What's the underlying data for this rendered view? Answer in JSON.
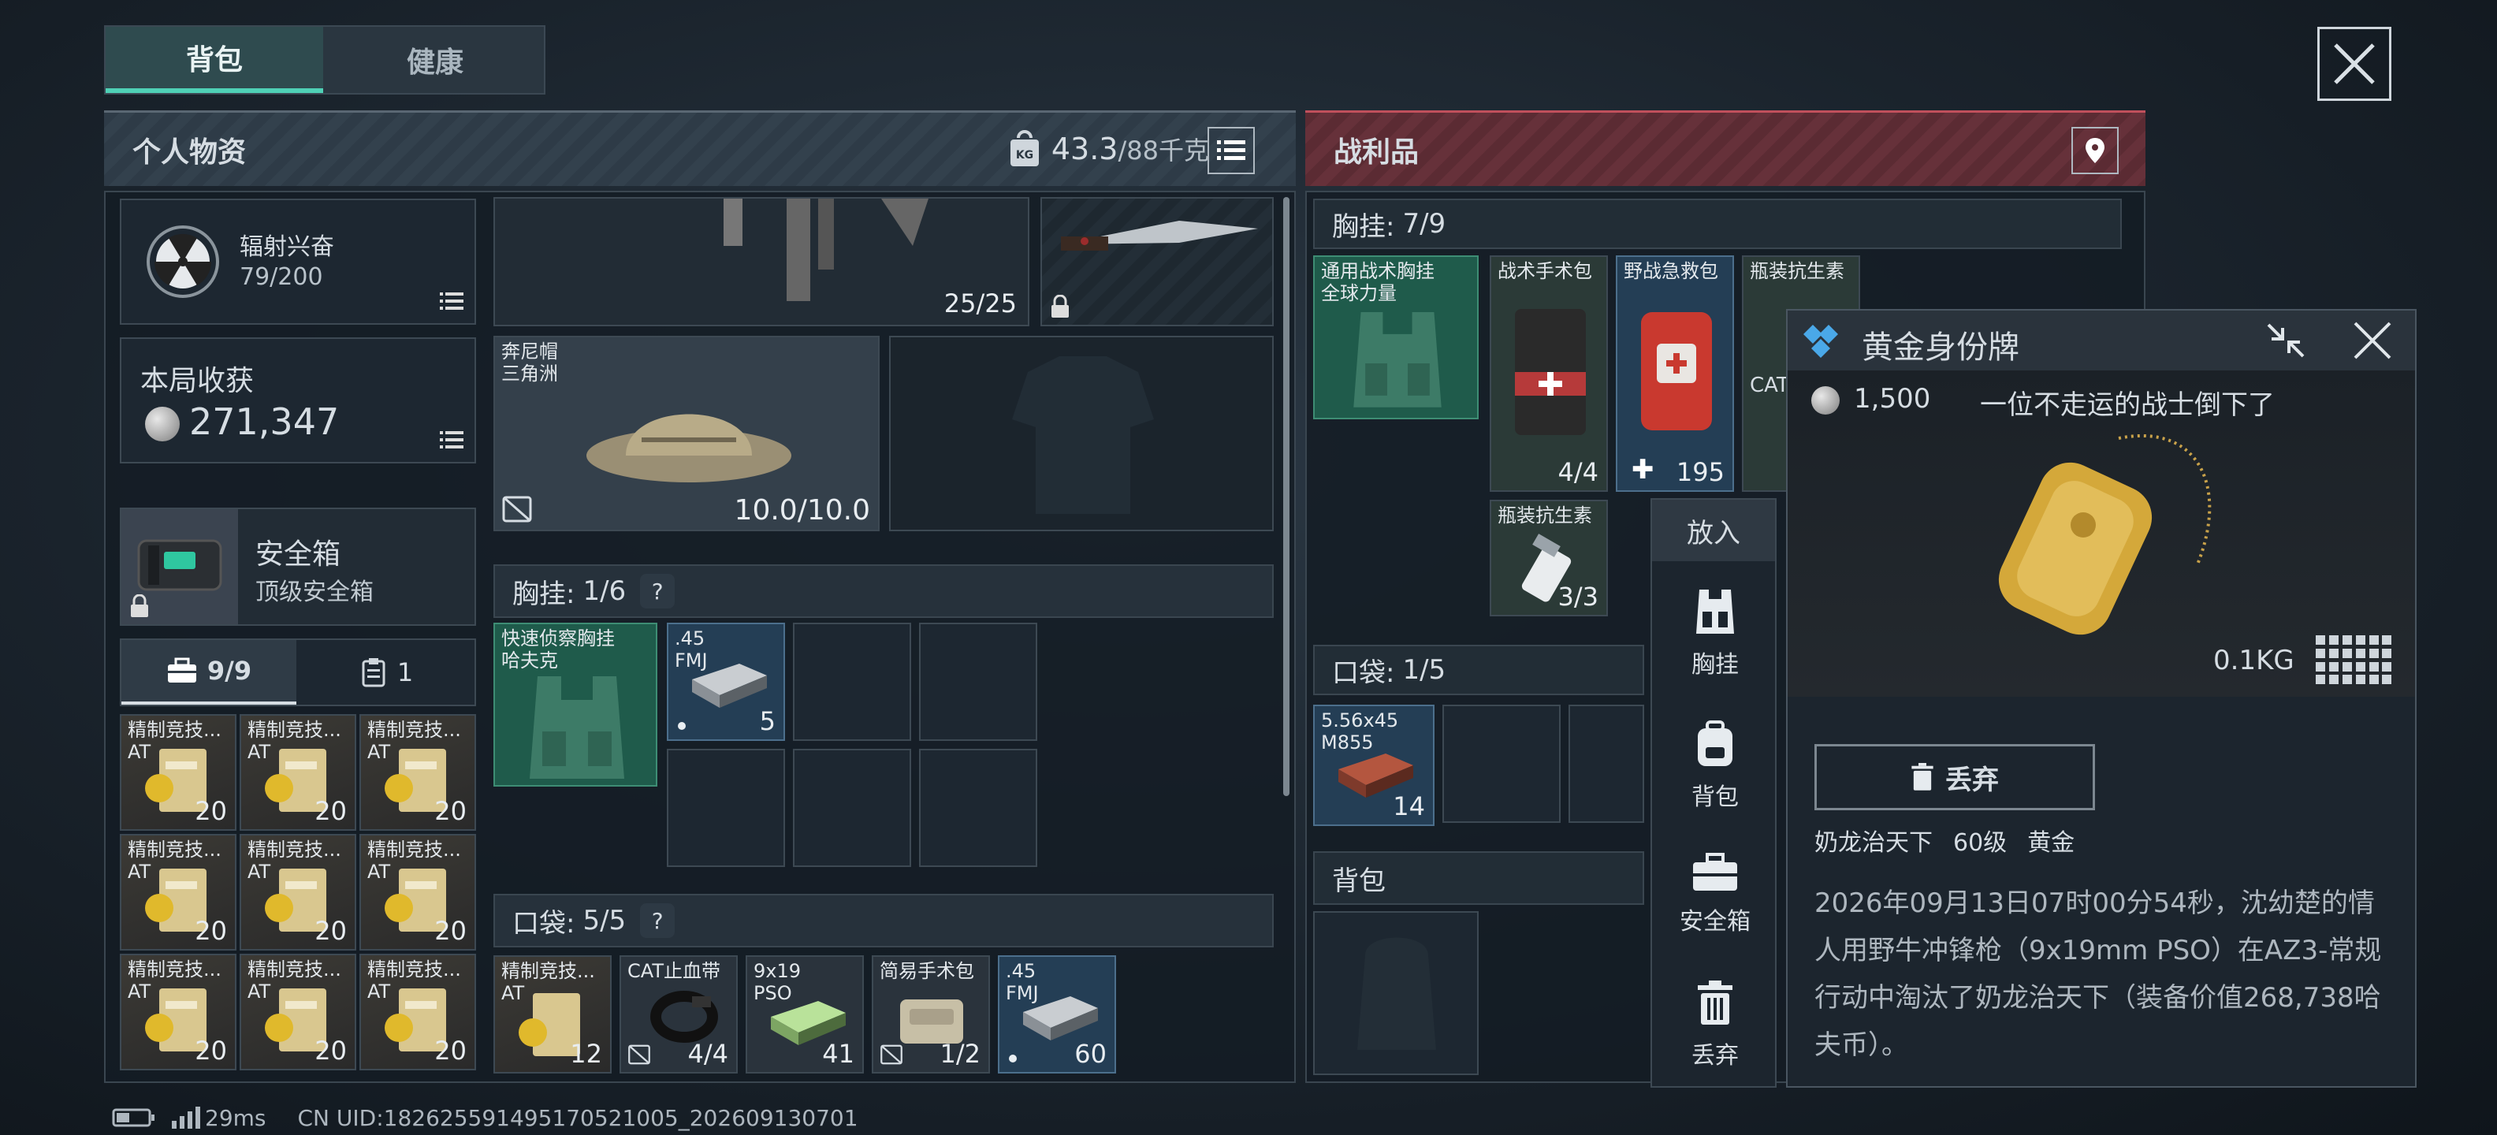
{
  "tabs": {
    "backpack": "背包",
    "health": "健康"
  },
  "left_header": {
    "title": "个人物资",
    "weight_current": "43.3",
    "weight_max": "/88千克"
  },
  "right_header": {
    "title": "战利品"
  },
  "stats": {
    "radiation_label": "辐射兴奋",
    "radiation_value": "79/200",
    "harvest_label": "本局收获",
    "harvest_value": "271,347"
  },
  "safe_box": {
    "title": "安全箱",
    "subtitle": "顶级安全箱"
  },
  "storage_tabs": {
    "case_count": "9/9",
    "clipboard_count": "1"
  },
  "grid_items": {
    "label": "精制竞技...\nAT",
    "count": "20"
  },
  "weapon_slots": {
    "rifle_ammo": "25/25"
  },
  "hat": {
    "name": "奔尼帽\n三角洲",
    "durability": "10.0/10.0"
  },
  "chest_rig_section": {
    "label": "胸挂:",
    "value": "1/6",
    "help": "?"
  },
  "chest_rig_item": {
    "name": "快速侦察胸挂\n哈夫克"
  },
  "ammo_45": {
    "name": ".45\nFMJ",
    "count": "5"
  },
  "pockets_section": {
    "label": "口袋:",
    "value": "5/5",
    "help": "?"
  },
  "pocket_items": [
    {
      "name": "精制竞技...\nAT",
      "count": "12"
    },
    {
      "name": "CAT止血带",
      "count": "4/4"
    },
    {
      "name": "9x19\nPSO",
      "count": "41"
    },
    {
      "name": "简易手术包",
      "count": "1/2"
    },
    {
      "name": ".45\nFMJ",
      "count": "60"
    }
  ],
  "loot": {
    "chest_rig_label": "胸挂:",
    "chest_rig_value": "7/9",
    "rig_item": "通用战术胸挂\n全球力量",
    "surgery_kit": {
      "name": "战术手术包",
      "count": "4/4"
    },
    "field_kit": {
      "name": "野战急救包",
      "count": "195"
    },
    "antibiotic": {
      "name": "瓶装抗生素",
      "count": "3/3"
    },
    "antibiotic_top": "瓶装抗生素",
    "cat_partial": "CAT",
    "pockets_label": "口袋:",
    "pockets_value": "1/5",
    "ammo_556": {
      "name": "5.56x45\nM855",
      "count": "14"
    },
    "backpack_label": "背包"
  },
  "side_menu": {
    "title": "放入",
    "chest": "胸挂",
    "backpack": "背包",
    "safe": "安全箱",
    "discard": "丢弃"
  },
  "popup": {
    "title": "黄金身份牌",
    "price": "1,500",
    "tagline": "一位不走运的战士倒下了",
    "weight": "0.1KG",
    "discard_button": "丢弃",
    "owner_name": "奶龙治天下",
    "owner_level": "60级",
    "owner_rank": "黄金",
    "description": "2026年09月13日07时00分54秒，沈幼楚的情人用野牛冲锋枪（9x19mm PSO）在AZ3-常规行动中淘汰了奶龙治天下（装备价值268,738哈夫币）。"
  },
  "status_bar": {
    "ping": "29ms",
    "uid": "CN UID:182625591495170521005_202609130701"
  },
  "colors": {
    "accent": "#4fd1b6",
    "loot_red": "#c0505c",
    "green_slot": "#1f5b4b"
  }
}
